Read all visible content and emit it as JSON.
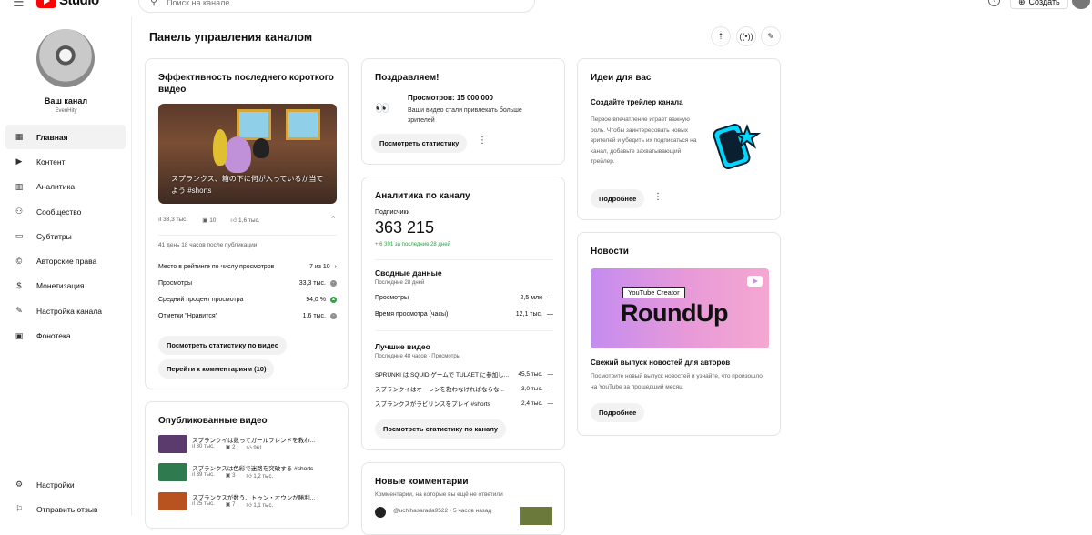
{
  "app": {
    "logo_text": "Studio",
    "brand_color": "#ff0000"
  },
  "search": {
    "placeholder": "Поиск на канале"
  },
  "topbar": {
    "create_label": "Создать"
  },
  "channel": {
    "name": "Ваш канал",
    "handle": "EvenHity"
  },
  "sidebar": {
    "items": [
      {
        "label": "Главная",
        "icon": "dashboard-icon",
        "active": true
      },
      {
        "label": "Контент",
        "icon": "content-icon"
      },
      {
        "label": "Аналитика",
        "icon": "analytics-icon"
      },
      {
        "label": "Сообщество",
        "icon": "community-icon"
      },
      {
        "label": "Субтитры",
        "icon": "subtitles-icon"
      },
      {
        "label": "Авторские права",
        "icon": "copyright-icon"
      },
      {
        "label": "Монетизация",
        "icon": "monetization-icon"
      },
      {
        "label": "Настройка канала",
        "icon": "customization-icon"
      },
      {
        "label": "Фонотека",
        "icon": "audio-library-icon"
      }
    ],
    "bottom": [
      {
        "label": "Настройки",
        "icon": "settings-icon"
      },
      {
        "label": "Отправить отзыв",
        "icon": "feedback-icon"
      }
    ]
  },
  "page": {
    "title": "Панель управления каналом"
  },
  "latest_short": {
    "title": "Эффективность последнего короткого видео",
    "thumb_caption": "スプランクス、箱の下に何が入っているか当てよう #shorts",
    "views": "33,3 тыс.",
    "comments": "10",
    "likes": "1,6 тыс.",
    "age": "41 день 18 часов после публикации",
    "metrics": [
      {
        "label": "Место в рейтинге по числу просмотров",
        "value": "7 из 10"
      },
      {
        "label": "Просмотры",
        "value": "33,3 тыс."
      },
      {
        "label": "Средний процент просмотра",
        "value": "94,0 %"
      },
      {
        "label": "Отметки \"Нравится\"",
        "value": "1,6 тыс."
      }
    ],
    "btn_stats": "Посмотреть статистику по видео",
    "btn_comments": "Перейти к комментариям (10)"
  },
  "published": {
    "title": "Опубликованные видео",
    "items": [
      {
        "title": "スプランクイは数ってガールフレンドを救わ...",
        "views": "30 тыс.",
        "comments": "2",
        "likes": "961",
        "color": "#5b3a6e"
      },
      {
        "title": "スプランクスは色彩で迷路を突破する #shorts",
        "views": "39 тыс.",
        "comments": "3",
        "likes": "1,2 тыс.",
        "color": "#2f7a4e"
      },
      {
        "title": "スプランクスが数う、トゥン・オウンが勝利...",
        "views": "25 тыс.",
        "comments": "7",
        "likes": "1,1 тыс.",
        "color": "#b8521f"
      }
    ]
  },
  "congrats": {
    "title": "Поздравляем!",
    "headline": "Просмотров: 15 000 000",
    "text": "Ваши видео стали привлекать больше зрителей",
    "button": "Посмотреть статистику"
  },
  "analytics": {
    "title": "Аналитика по каналу",
    "subs_label": "Подписчики",
    "subs_value": "363 215",
    "subs_delta": "+ 6 391 за последние 28 дней",
    "summary_title": "Сводные данные",
    "summary_period": "Последние 28 дней",
    "summary": [
      {
        "label": "Просмотры",
        "value": "2,5 млн",
        "trend": "—"
      },
      {
        "label": "Время просмотра (часы)",
        "value": "12,1 тыс.",
        "trend": "—"
      }
    ],
    "top_title": "Лучшие видео",
    "top_period": "Последние 48 часов · Просмотры",
    "top": [
      {
        "title": "SPRUNKI は SQUID ゲームで TULAET に参加し...",
        "value": "45,5 тыс."
      },
      {
        "title": "スプランクイはオーレンを救わなければならな...",
        "value": "3,0 тыс."
      },
      {
        "title": "スプランクスがラビリンスをプレイ #shorts",
        "value": "2,4 тыс."
      }
    ],
    "button": "Посмотреть статистику по каналу"
  },
  "comments": {
    "title": "Новые комментарии",
    "subtitle": "Комментарии, на которые вы ещё не ответили",
    "first_author": "@uchihasarada9522",
    "first_time": "5 часов назад"
  },
  "ideas": {
    "title": "Идеи для вас",
    "subtitle": "Создайте трейлер канала",
    "text": "Первое впечатление играет важную роль. Чтобы заинтересовать новых зрителей и убедить их подписаться на канал, добавьте захватывающий трейлер.",
    "button": "Подробнее"
  },
  "news": {
    "title": "Новости",
    "banner_small": "YouTube Creator",
    "banner_big": "RoundUp",
    "headline": "Свежий выпуск новостей для авторов",
    "text": "Посмотрите новый выпуск новостей и узнайте, что произошло на YouTube за прошедший месяц.",
    "button": "Подробнее"
  }
}
